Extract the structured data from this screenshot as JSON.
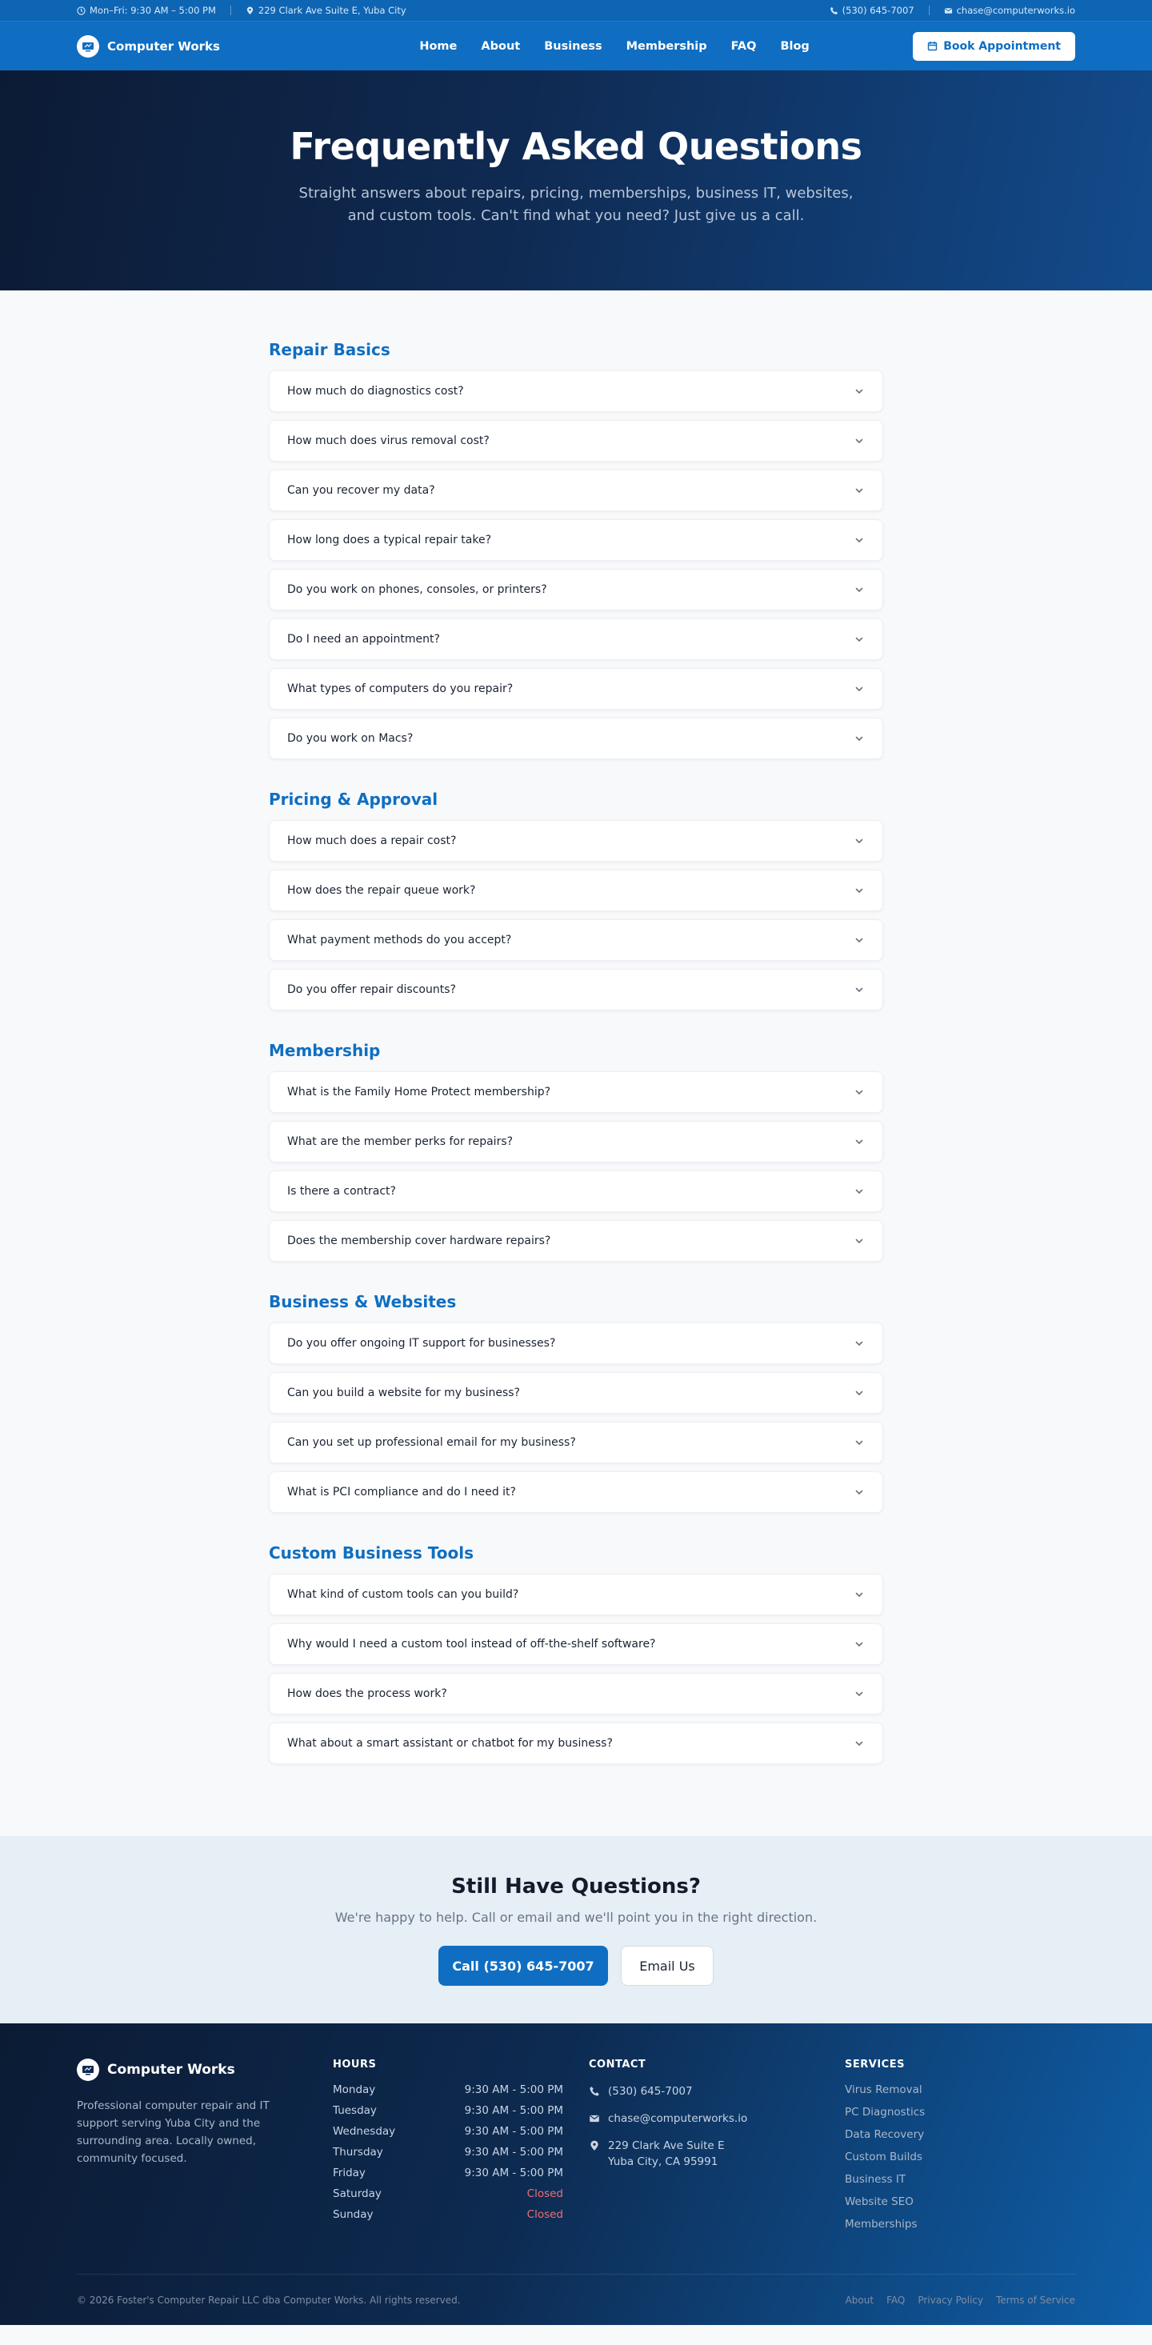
{
  "topbar": {
    "hours": "Mon–Fri: 9:30 AM – 5:00 PM",
    "address": "229 Clark Ave Suite E, Yuba City",
    "phone": "(530) 645-7007",
    "email": "chase@computerworks.io"
  },
  "nav": {
    "brand": "Computer Works",
    "links": [
      "Home",
      "About",
      "Business",
      "Membership",
      "FAQ",
      "Blog"
    ],
    "cta": "Book Appointment"
  },
  "hero": {
    "title": "Frequently Asked Questions",
    "subtitle": "Straight answers about repairs, pricing, memberships, business IT, websites, and custom tools. Can't find what you need? Just give us a call."
  },
  "faq": [
    {
      "heading": "Repair Basics",
      "questions": [
        "How much do diagnostics cost?",
        "How much does virus removal cost?",
        "Can you recover my data?",
        "How long does a typical repair take?",
        "Do you work on phones, consoles, or printers?",
        "Do I need an appointment?",
        "What types of computers do you repair?",
        "Do you work on Macs?"
      ]
    },
    {
      "heading": "Pricing & Approval",
      "questions": [
        "How much does a repair cost?",
        "How does the repair queue work?",
        "What payment methods do you accept?",
        "Do you offer repair discounts?"
      ]
    },
    {
      "heading": "Membership",
      "questions": [
        "What is the Family Home Protect membership?",
        "What are the member perks for repairs?",
        "Is there a contract?",
        "Does the membership cover hardware repairs?"
      ]
    },
    {
      "heading": "Business & Websites",
      "questions": [
        "Do you offer ongoing IT support for businesses?",
        "Can you build a website for my business?",
        "Can you set up professional email for my business?",
        "What is PCI compliance and do I need it?"
      ]
    },
    {
      "heading": "Custom Business Tools",
      "questions": [
        "What kind of custom tools can you build?",
        "Why would I need a custom tool instead of off-the-shelf software?",
        "How does the process work?",
        "What about a smart assistant or chatbot for my business?"
      ]
    }
  ],
  "cta": {
    "title": "Still Have Questions?",
    "subtitle": "We're happy to help. Call or email and we'll point you in the right direction.",
    "call_label": "Call (530) 645-7007",
    "email_label": "Email Us"
  },
  "footer": {
    "brand": "Computer Works",
    "about": "Professional computer repair and IT support serving Yuba City and the surrounding area. Locally owned, community focused.",
    "hours_heading": "HOURS",
    "hours": [
      {
        "day": "Monday",
        "time": "9:30 AM - 5:00 PM"
      },
      {
        "day": "Tuesday",
        "time": "9:30 AM - 5:00 PM"
      },
      {
        "day": "Wednesday",
        "time": "9:30 AM - 5:00 PM"
      },
      {
        "day": "Thursday",
        "time": "9:30 AM - 5:00 PM"
      },
      {
        "day": "Friday",
        "time": "9:30 AM - 5:00 PM"
      },
      {
        "day": "Saturday",
        "time": "Closed"
      },
      {
        "day": "Sunday",
        "time": "Closed"
      }
    ],
    "contact_heading": "CONTACT",
    "phone": "(530) 645-7007",
    "email": "chase@computerworks.io",
    "address_line1": "229 Clark Ave Suite E",
    "address_line2": "Yuba City, CA 95991",
    "services_heading": "SERVICES",
    "services": [
      "Virus Removal",
      "PC Diagnostics",
      "Data Recovery",
      "Custom Builds",
      "Business IT",
      "Website SEO",
      "Memberships"
    ],
    "copyright": "© 2026 Foster's Computer Repair LLC dba Computer Works. All rights reserved.",
    "legal_links": [
      "About",
      "FAQ",
      "Privacy Policy",
      "Terms of Service"
    ]
  }
}
